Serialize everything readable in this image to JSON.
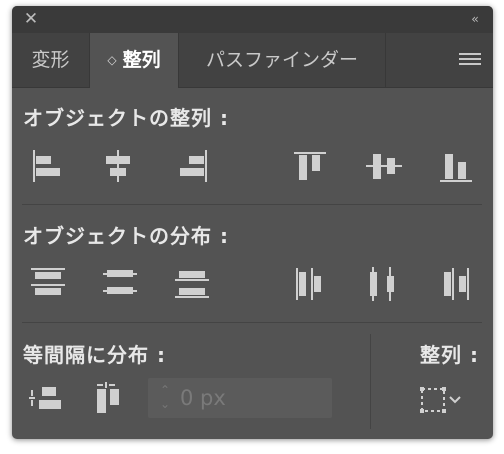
{
  "window": {
    "close_glyph": "✕",
    "collapse_glyph": "‹‹"
  },
  "tabs": [
    {
      "label": "変形",
      "active": false
    },
    {
      "label": "整列",
      "active": true
    },
    {
      "label": "パスファインダー",
      "active": false
    }
  ],
  "active_tab_arrows": "◇",
  "sections": {
    "align_objects": {
      "label": "オブジェクトの整列 :",
      "buttons": [
        "horizontal-align-left-icon",
        "horizontal-align-center-icon",
        "horizontal-align-right-icon",
        "vertical-align-top-icon",
        "vertical-align-center-icon",
        "vertical-align-bottom-icon"
      ]
    },
    "distribute_objects": {
      "label": "オブジェクトの分布 :",
      "buttons": [
        "vertical-distribute-top-icon",
        "vertical-distribute-center-icon",
        "vertical-distribute-bottom-icon",
        "horizontal-distribute-left-icon",
        "horizontal-distribute-center-icon",
        "horizontal-distribute-right-icon"
      ]
    },
    "distribute_spacing": {
      "label": "等間隔に分布 :",
      "spacing_value": "",
      "spacing_placeholder": "0 px"
    },
    "align_to": {
      "label": "整列 :"
    }
  },
  "colors": {
    "panel_bg": "#535353",
    "tabbar_bg": "#424242",
    "icon": "#d0d0d0"
  }
}
